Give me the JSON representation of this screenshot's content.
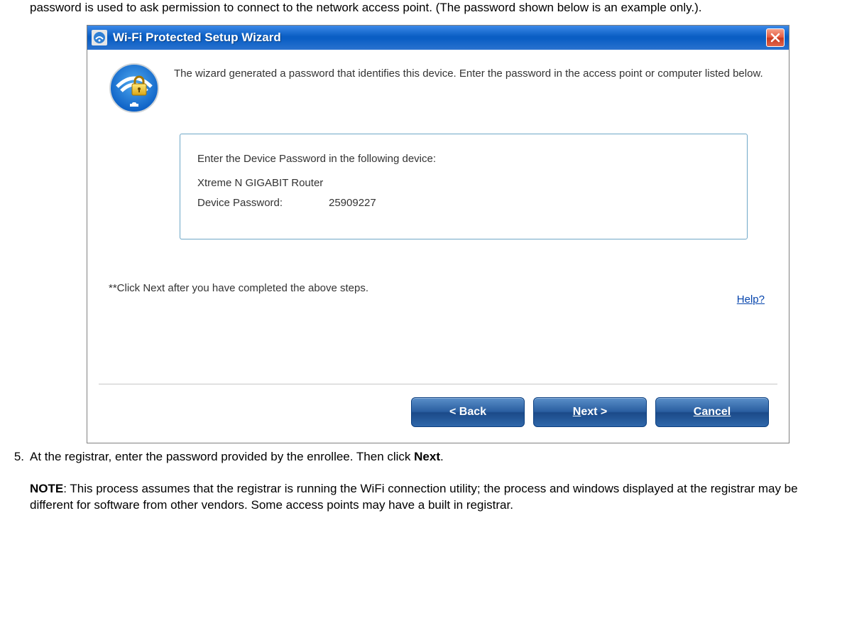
{
  "intro": "password is used to ask permission to connect to the network access point. (The password shown below is an example only.).",
  "wizard": {
    "title": "Wi-Fi Protected Setup Wizard",
    "instruction": "The wizard generated a password that identifies this device. Enter the password in the access point or computer listed below.",
    "box_title": "Enter the Device Password in the following device:",
    "device_name": "Xtreme N GIGABIT Router",
    "password_label": "Device Password:",
    "password_value": "25909227",
    "next_note": "**Click Next after you have completed the above steps.",
    "help_link": "Help?",
    "buttons": {
      "back": "< Back",
      "next_underline": "N",
      "next_rest": "ext >",
      "cancel": "Cancel"
    }
  },
  "step": {
    "number": "5.",
    "text_before": "At the registrar, enter the password provided by the enrollee. Then click ",
    "bold": "Next",
    "text_after": "."
  },
  "note": {
    "label": "NOTE",
    "text": ": This process assumes that the registrar is running the WiFi connection utility; the process and windows displayed at the registrar may be different for software from other vendors. Some access points may have a built in registrar."
  }
}
